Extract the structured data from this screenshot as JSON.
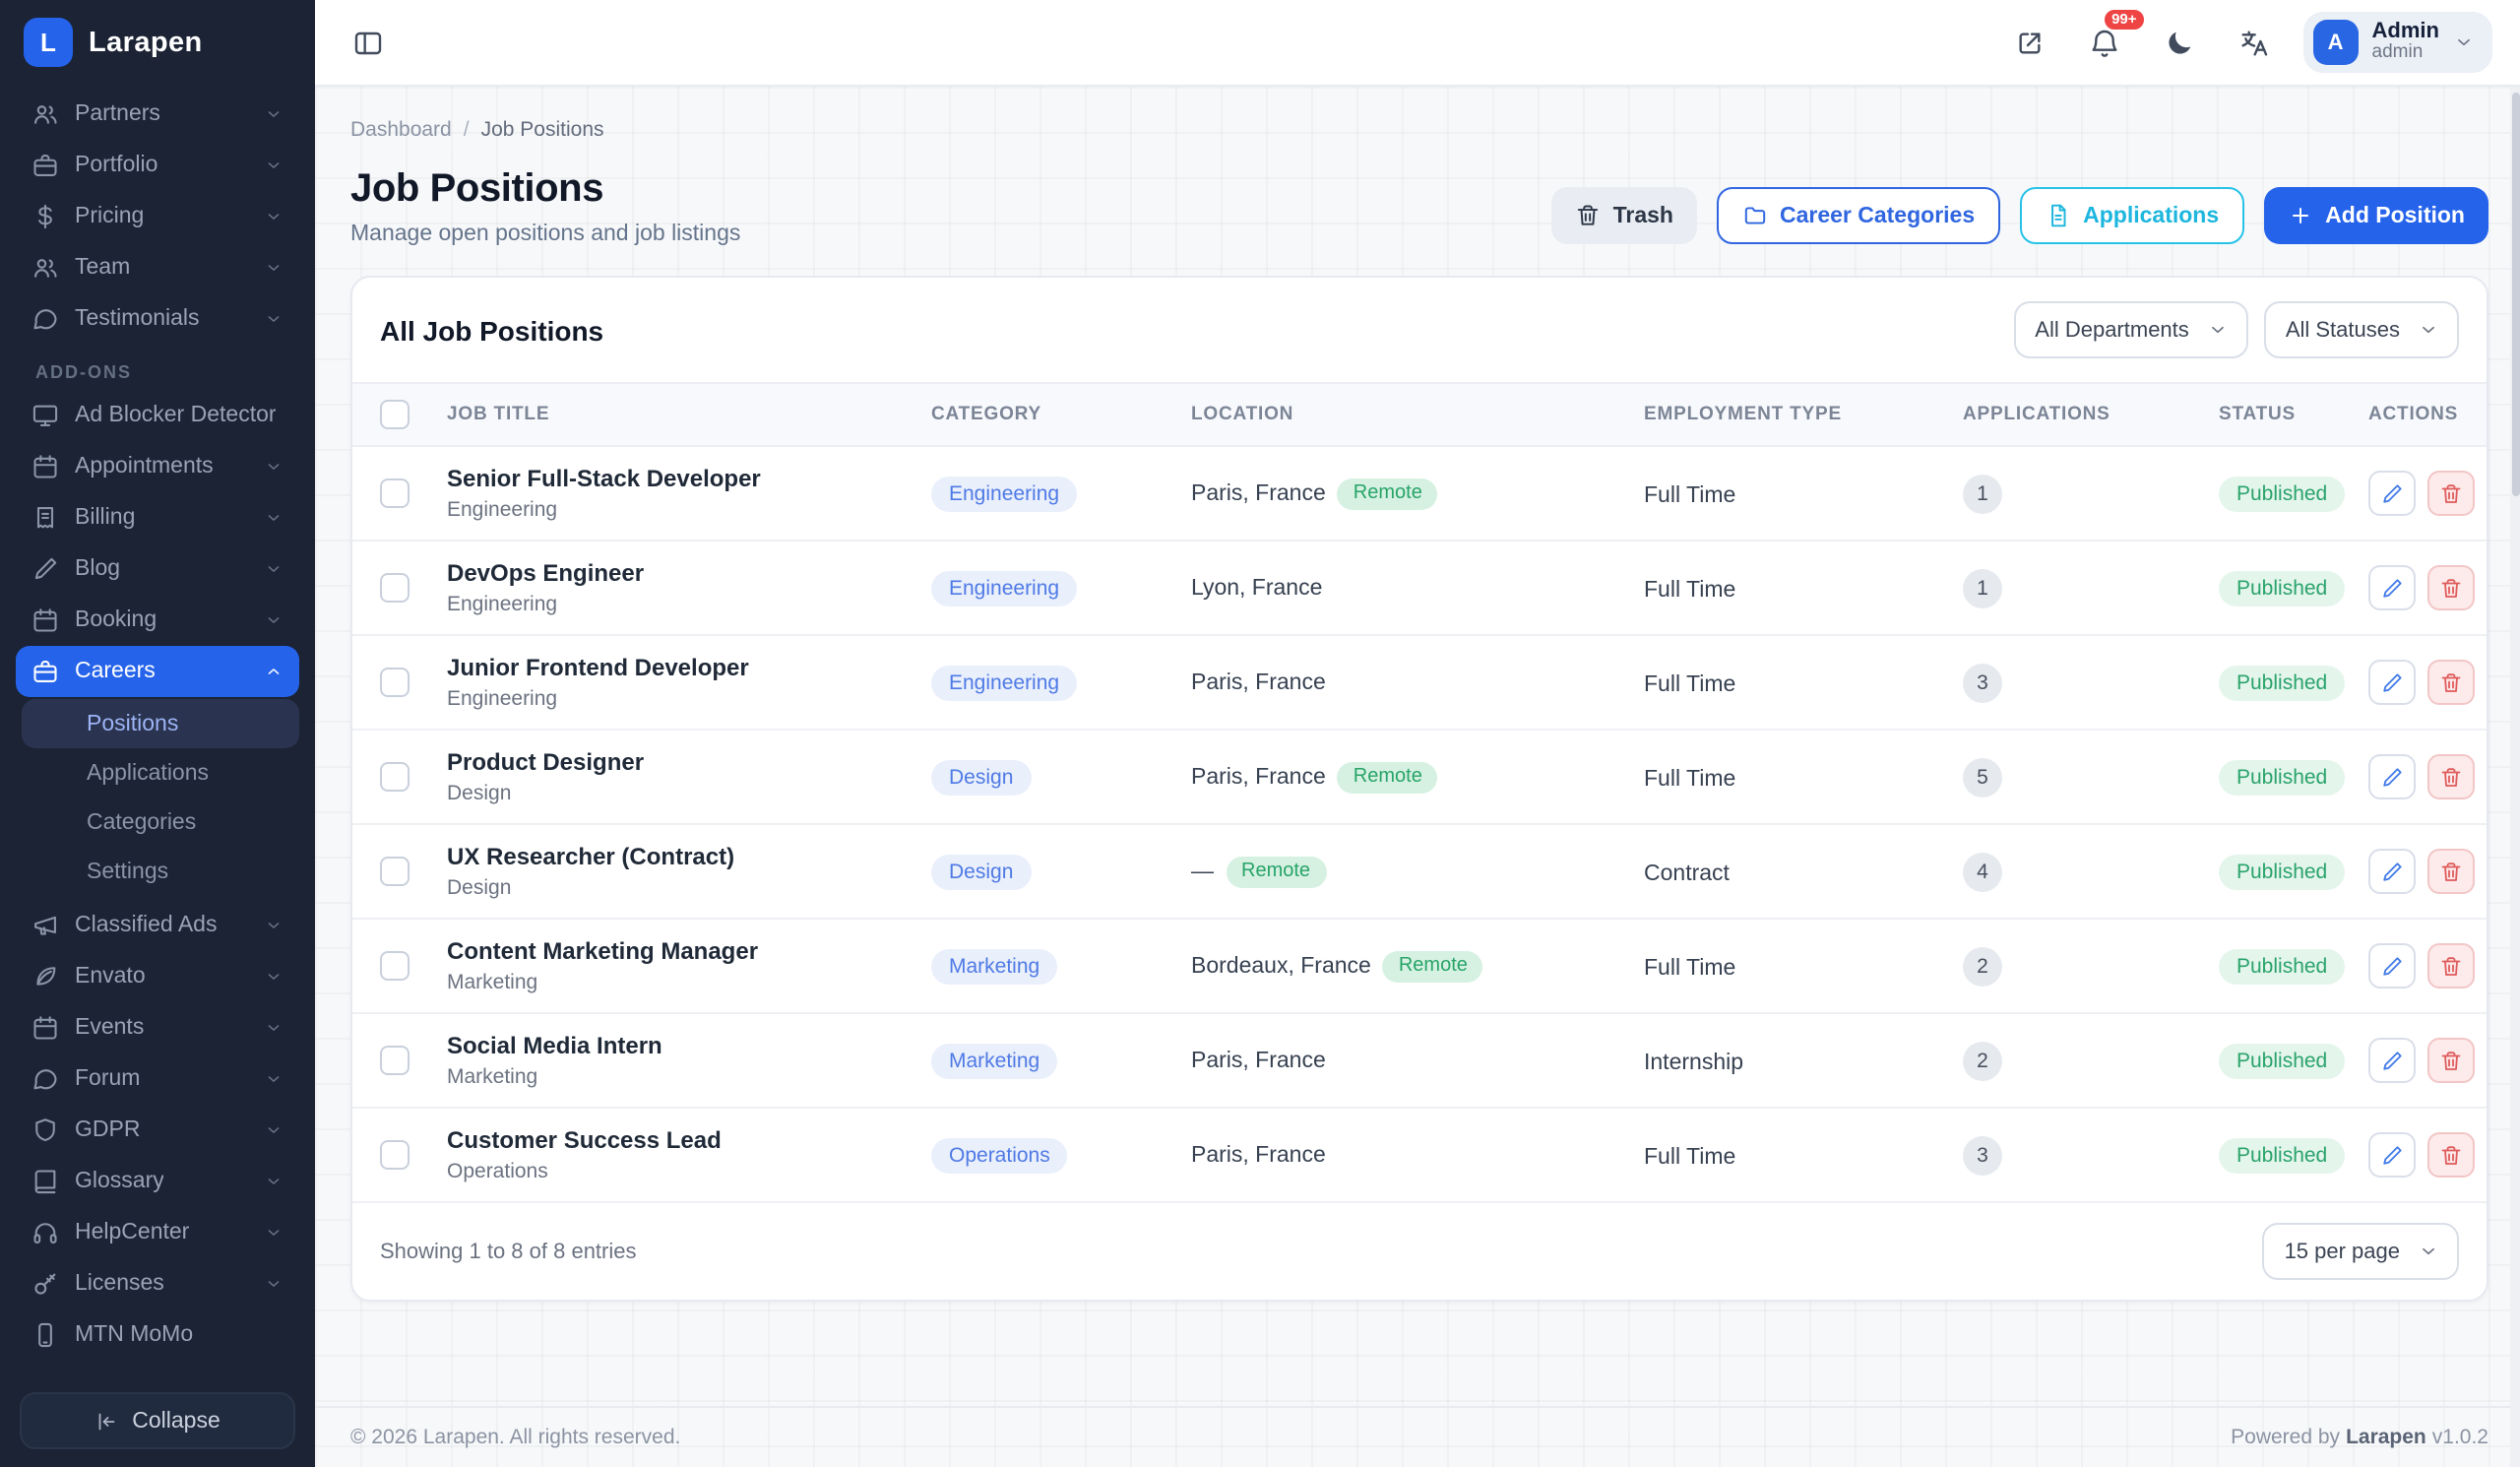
{
  "brand": {
    "logo_letter": "L",
    "name": "Larapen"
  },
  "topbar": {
    "notification_badge": "99+",
    "user": {
      "avatar_letter": "A",
      "name": "Admin",
      "role": "admin"
    }
  },
  "sidebar": {
    "items": [
      {
        "label": "Partners"
      },
      {
        "label": "Portfolio"
      },
      {
        "label": "Pricing"
      },
      {
        "label": "Team"
      },
      {
        "label": "Testimonials"
      }
    ],
    "addons_heading": "ADD-ONS",
    "addons": [
      {
        "label": "Ad Blocker Detector"
      },
      {
        "label": "Appointments"
      },
      {
        "label": "Billing"
      },
      {
        "label": "Blog"
      },
      {
        "label": "Booking"
      },
      {
        "label": "Careers"
      },
      {
        "label": "Classified Ads"
      },
      {
        "label": "Envato"
      },
      {
        "label": "Events"
      },
      {
        "label": "Forum"
      },
      {
        "label": "GDPR"
      },
      {
        "label": "Glossary"
      },
      {
        "label": "HelpCenter"
      },
      {
        "label": "Licenses"
      },
      {
        "label": "MTN MoMo"
      }
    ],
    "careers_children": [
      {
        "label": "Positions"
      },
      {
        "label": "Applications"
      },
      {
        "label": "Categories"
      },
      {
        "label": "Settings"
      }
    ],
    "collapse_label": "Collapse"
  },
  "breadcrumb": {
    "items": [
      "Dashboard",
      "Job Positions"
    ],
    "separator": "/"
  },
  "page": {
    "title": "Job Positions",
    "subtitle": "Manage open positions and job listings"
  },
  "actions": {
    "trash": "Trash",
    "career_categories": "Career Categories",
    "applications": "Applications",
    "add_position": "Add Position"
  },
  "filters": {
    "departments": "All Departments",
    "statuses": "All Statuses"
  },
  "table": {
    "title": "All Job Positions",
    "columns": [
      "JOB TITLE",
      "CATEGORY",
      "LOCATION",
      "EMPLOYMENT TYPE",
      "APPLICATIONS",
      "STATUS",
      "ACTIONS"
    ],
    "labels": {
      "remote": "Remote"
    },
    "rows": [
      {
        "title": "Senior Full-Stack Developer",
        "dept": "Engineering",
        "category": "Engineering",
        "location": "Paris, France",
        "remote": true,
        "type": "Full Time",
        "applications": "1",
        "status": "Published"
      },
      {
        "title": "DevOps Engineer",
        "dept": "Engineering",
        "category": "Engineering",
        "location": "Lyon, France",
        "remote": false,
        "type": "Full Time",
        "applications": "1",
        "status": "Published"
      },
      {
        "title": "Junior Frontend Developer",
        "dept": "Engineering",
        "category": "Engineering",
        "location": "Paris, France",
        "remote": false,
        "type": "Full Time",
        "applications": "3",
        "status": "Published"
      },
      {
        "title": "Product Designer",
        "dept": "Design",
        "category": "Design",
        "location": "Paris, France",
        "remote": true,
        "type": "Full Time",
        "applications": "5",
        "status": "Published"
      },
      {
        "title": "UX Researcher (Contract)",
        "dept": "Design",
        "category": "Design",
        "location": "—",
        "remote": true,
        "type": "Contract",
        "applications": "4",
        "status": "Published"
      },
      {
        "title": "Content Marketing Manager",
        "dept": "Marketing",
        "category": "Marketing",
        "location": "Bordeaux, France",
        "remote": true,
        "type": "Full Time",
        "applications": "2",
        "status": "Published"
      },
      {
        "title": "Social Media Intern",
        "dept": "Marketing",
        "category": "Marketing",
        "location": "Paris, France",
        "remote": false,
        "type": "Internship",
        "applications": "2",
        "status": "Published"
      },
      {
        "title": "Customer Success Lead",
        "dept": "Operations",
        "category": "Operations",
        "location": "Paris, France",
        "remote": false,
        "type": "Full Time",
        "applications": "3",
        "status": "Published"
      }
    ],
    "footer": {
      "summary": "Showing 1 to 8 of 8 entries",
      "per_page": "15 per page"
    }
  },
  "footer": {
    "copyright": "© 2026 Larapen. All rights reserved.",
    "powered_prefix": "Powered by",
    "powered_brand": "Larapen",
    "powered_version": "v1.0.2"
  },
  "colors": {
    "accent": "#2563eb",
    "cyan": "#22c0e6",
    "success": "#2aa36b",
    "danger": "#df5b5b",
    "sidebar_bg": "#1b2334"
  }
}
